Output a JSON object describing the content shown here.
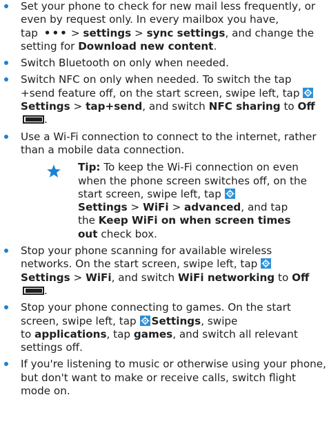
{
  "items": [
    {
      "t1": "Set your phone to check for new mail less frequently, or even by request only. In every mailbox you have, tap",
      "dots": "•••",
      "t2": ">",
      "b1": "settings",
      "t3": ">",
      "b2": "sync settings",
      "t4": ", and change the setting for",
      "b3": "Download new content",
      "t5": "."
    },
    {
      "t1": "Switch Bluetooth on only when needed."
    },
    {
      "t1": "Switch NFC on only when needed. To switch the tap +send feature off, on the start screen, swipe left, tap",
      "b1": "Settings",
      "t2": ">",
      "b2": "tap+send",
      "t3": ", and switch",
      "b3": "NFC sharing",
      "t4": "to",
      "b4": "Off",
      "t5": "."
    },
    {
      "t1": "Use a Wi-Fi connection to connect to the internet, rather than a mobile data connection."
    },
    {
      "t1": "Stop your phone scanning for available wireless networks. On the start screen, swipe left, tap",
      "b1": "Settings",
      "t2": ">",
      "b2": "WiFi",
      "t3": ", and switch",
      "b3": "WiFi networking",
      "t4": "to",
      "b4": "Off",
      "t5": "."
    },
    {
      "t1": "Stop your phone connecting to games. On the start screen, swipe left, tap",
      "b1": "Settings",
      "t2": ", swipe to",
      "b2": "applications",
      "t3": ", tap",
      "b3": "games",
      "t4": ", and switch all relevant settings off."
    },
    {
      "t1": "If you're listening to music or otherwise using your phone, but don't want to make or receive calls, switch flight mode on."
    }
  ],
  "tip": {
    "label": "Tip:",
    "t1": "To keep the Wi-Fi connection on even when the phone screen switches off, on the start screen, swipe left, tap",
    "b1": "Settings",
    "t2": ">",
    "b2": "WiFi",
    "t3": ">",
    "b3": "advanced",
    "t4": ", and tap the",
    "b4": "Keep WiFi on when screen times out",
    "t5": "check box."
  },
  "icons": {
    "settings": "settings-gear-icon",
    "toggle": "toggle-off-icon",
    "star": "star-icon",
    "more": "more-dots-icon"
  },
  "colors": {
    "bullet": "#1a82d4",
    "settings_icon": "#2b8fd8",
    "star": "#1a82d4"
  }
}
